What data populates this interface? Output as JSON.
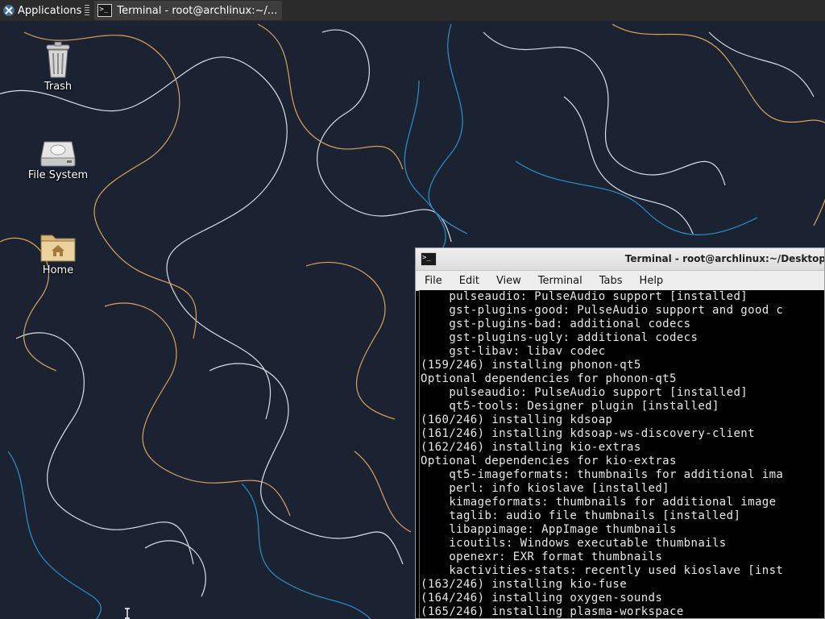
{
  "panel": {
    "applications_label": "Applications",
    "task_title": "Terminal - root@archlinux:~/..."
  },
  "desktop": {
    "icons": [
      {
        "label": "Trash",
        "icon": "trash-icon"
      },
      {
        "label": "File System",
        "icon": "drive-icon"
      },
      {
        "label": "Home",
        "icon": "home-folder-icon"
      }
    ]
  },
  "terminal": {
    "title": "Terminal - root@archlinux:~/Desktop",
    "menu": [
      "File",
      "Edit",
      "View",
      "Terminal",
      "Tabs",
      "Help"
    ],
    "lines": [
      "    pulseaudio: PulseAudio support [installed]",
      "    gst-plugins-good: PulseAudio support and good c",
      "    gst-plugins-bad: additional codecs",
      "    gst-plugins-ugly: additional codecs",
      "    gst-libav: libav codec",
      "(159/246) installing phonon-qt5",
      "Optional dependencies for phonon-qt5",
      "    pulseaudio: PulseAudio support [installed]",
      "    qt5-tools: Designer plugin [installed]",
      "(160/246) installing kdsoap",
      "(161/246) installing kdsoap-ws-discovery-client",
      "(162/246) installing kio-extras",
      "Optional dependencies for kio-extras",
      "    qt5-imageformats: thumbnails for additional ima",
      "    perl: info kioslave [installed]",
      "    kimageformats: thumbnails for additional image",
      "    taglib: audio file thumbnails [installed]",
      "    libappimage: AppImage thumbnails",
      "    icoutils: Windows executable thumbnails",
      "    openexr: EXR format thumbnails",
      "    kactivities-stats: recently used kioslave [inst",
      "(163/246) installing kio-fuse",
      "(164/246) installing oxygen-sounds",
      "(165/246) installing plasma-workspace"
    ]
  },
  "colors": {
    "wallpaper_bg": "#1b2333",
    "contour_white": "#d8dde6",
    "contour_orange": "#d9a25a",
    "contour_blue": "#2f8fc9",
    "panel_bg": "#2b2b2b"
  }
}
